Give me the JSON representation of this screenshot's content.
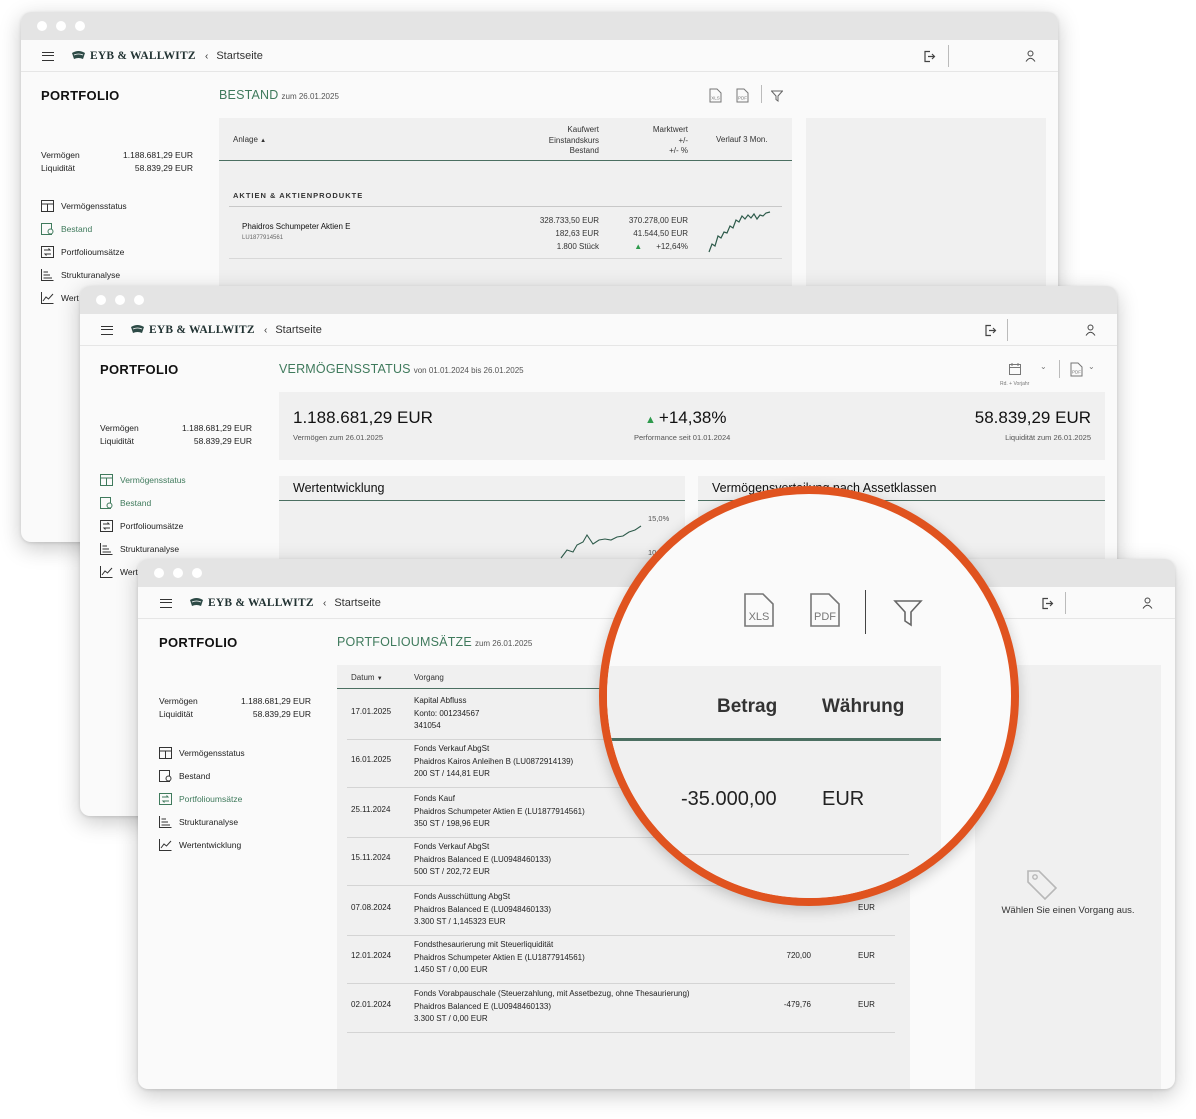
{
  "common": {
    "logo": "EYB & WALLWITZ",
    "breadcrumb": "Startseite",
    "portfolio_heading": "PORTFOLIO",
    "vermoegen_label": "Vermögen",
    "vermoegen_value": "1.188.681,29 EUR",
    "liquiditaet_label": "Liquidität",
    "liquiditaet_value": "58.839,29 EUR",
    "nav": [
      "Vermögensstatus",
      "Bestand",
      "Portfolioumsätze",
      "Strukturanalyse",
      "Wertentwicklung"
    ],
    "nav_truncated_w1": "Wert",
    "nav_truncated_w2": "Wert",
    "accent_color": "#3f7a5c",
    "highlight_color": "#e0531f"
  },
  "win1": {
    "title": "BESTAND",
    "subtitle": "zum 26.01.2025",
    "columns": {
      "anlage": "Anlage",
      "kaufwert": "Kaufwert",
      "einstandskurs": "Einstandskurs",
      "bestand": "Bestand",
      "marktwert": "Marktwert",
      "pm": "+/-",
      "pm_pct": "+/- %",
      "verlauf": "Verlauf 3 Mon."
    },
    "section": "AKTIEN & AKTIENPRODUKTE",
    "position": {
      "name": "Phaidros Schumpeter Aktien E",
      "isin": "LU1877914561",
      "kaufwert": "328.733,50 EUR",
      "einstandskurs": "182,63 EUR",
      "bestand": "1.800 Stück",
      "marktwert": "370.278,00 EUR",
      "pm": "41.544,50 EUR",
      "pm_pct": "+12,64%"
    }
  },
  "win2": {
    "title": "VERMÖGENSSTATUS",
    "subtitle": "von 01.01.2024 bis 26.01.2025",
    "compare_label": "Rd. + Vorjahr",
    "vermoegen_big": "1.188.681,29 EUR",
    "vermoegen_caption": "Vermögen zum 26.01.2025",
    "performance_big": "+14,38%",
    "performance_caption": "Performance seit 01.01.2024",
    "liquiditaet_big": "58.839,29 EUR",
    "liquiditaet_caption": "Liquidität zum 26.01.2025",
    "wertentwicklung_title": "Wertentwicklung",
    "verteilung_title": "Vermögensverteilung nach Assetklassen",
    "axis_tick_1": "15,0%",
    "axis_tick_2": "10"
  },
  "win3": {
    "title": "PORTFOLIOUMSÄTZE",
    "subtitle": "zum 26.01.2025",
    "col_datum": "Datum",
    "col_vorgang": "Vorgang",
    "rows": [
      {
        "datum": "17.01.2025",
        "l1": "Kapital Abfluss",
        "l2": "Konto: 001234567",
        "l3": "341054",
        "betrag": "",
        "waehrung": ""
      },
      {
        "datum": "16.01.2025",
        "l1": "Fonds Verkauf AbgSt",
        "l2": "Phaidros Kairos Anleihen B (LU0872914139)",
        "l3": "200 ST / 144,81 EUR",
        "betrag": "",
        "waehrung": ""
      },
      {
        "datum": "25.11.2024",
        "l1": "Fonds Kauf",
        "l2": "Phaidros Schumpeter Aktien E (LU1877914561)",
        "l3": "350 ST / 198,96 EUR",
        "betrag": "",
        "waehrung": ""
      },
      {
        "datum": "15.11.2024",
        "l1": "Fonds Verkauf AbgSt",
        "l2": "Phaidros Balanced E (LU0948460133)",
        "l3": "500 ST / 202,72 EUR",
        "betrag": "",
        "waehrung": ""
      },
      {
        "datum": "07.08.2024",
        "l1": "Fonds Ausschüttung AbgSt",
        "l2": "Phaidros Balanced E (LU0948460133)",
        "l3": "3.300 ST / 1,145323 EUR",
        "betrag": "",
        "waehrung": "EUR"
      },
      {
        "datum": "12.01.2024",
        "l1": "Fondsthesaurierung mit Steuerliquidität",
        "l2": "Phaidros Schumpeter Aktien E (LU1877914561)",
        "l3": "1.450 ST / 0,00 EUR",
        "betrag": "720,00",
        "waehrung": "EUR"
      },
      {
        "datum": "02.01.2024",
        "l1": "Fonds Vorabpauschale (Steuerzahlung, mit Assetbezug, ohne Thesaurierung)",
        "l2": "Phaidros Balanced E (LU0948460133)",
        "l3": "3.300 ST / 0,00 EUR",
        "betrag": "-479,76",
        "waehrung": "EUR"
      }
    ],
    "empty_hint": "Wählen Sie einen Vorgang aus."
  },
  "magnifier": {
    "icon_xls": "XLS",
    "icon_pdf": "PDF",
    "col_betrag": "Betrag",
    "col_waehrung": "Währung",
    "betrag": "-35.000,00",
    "waehrung": "EUR",
    "peek_text": "EUR"
  }
}
